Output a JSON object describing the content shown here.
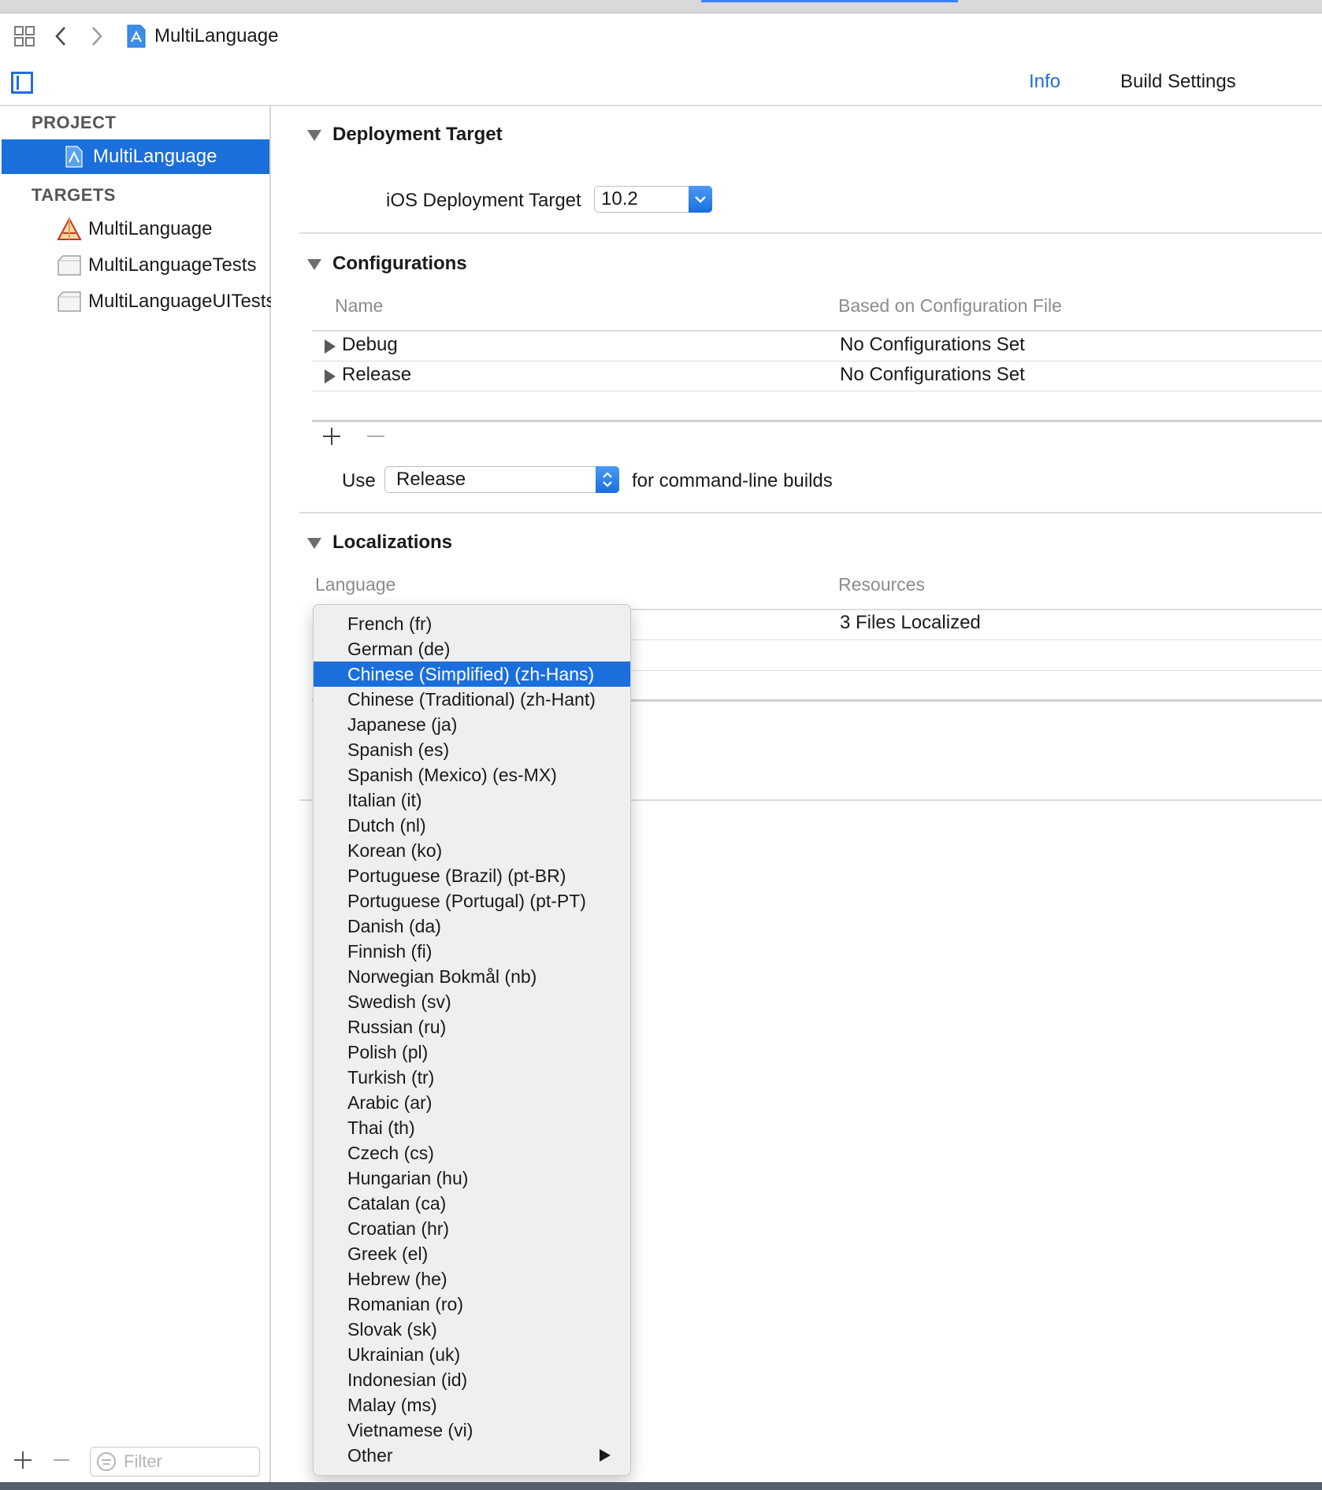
{
  "jumpbar": {
    "breadcrumb": "MultiLanguage"
  },
  "editor_tabs": [
    {
      "label": "Info",
      "active": true
    },
    {
      "label": "Build Settings",
      "active": false
    }
  ],
  "sidebar": {
    "project_header": "PROJECT",
    "project_item": "MultiLanguage",
    "targets_header": "TARGETS",
    "targets": [
      "MultiLanguage",
      "MultiLanguageTests",
      "MultiLanguageUITests"
    ],
    "filter_placeholder": "Filter"
  },
  "deployment": {
    "title": "Deployment Target",
    "label": "iOS Deployment Target",
    "value": "10.2"
  },
  "configurations": {
    "title": "Configurations",
    "col_name": "Name",
    "col_file": "Based on Configuration File",
    "rows": [
      {
        "name": "Debug",
        "file": "No Configurations Set"
      },
      {
        "name": "Release",
        "file": "No Configurations Set"
      }
    ],
    "use_label": "Use",
    "use_value": "Release",
    "use_suffix": "for command-line builds"
  },
  "localizations": {
    "title": "Localizations",
    "col_language": "Language",
    "col_resources": "Resources",
    "row_resources": "3 Files Localized"
  },
  "language_menu": {
    "highlighted_index": 2,
    "items": [
      "French (fr)",
      "German (de)",
      "Chinese (Simplified) (zh-Hans)",
      "Chinese (Traditional) (zh-Hant)",
      "Japanese (ja)",
      "Spanish (es)",
      "Spanish (Mexico) (es-MX)",
      "Italian (it)",
      "Dutch (nl)",
      "Korean (ko)",
      "Portuguese (Brazil) (pt-BR)",
      "Portuguese (Portugal) (pt-PT)",
      "Danish (da)",
      "Finnish (fi)",
      "Norwegian Bokmål (nb)",
      "Swedish (sv)",
      "Russian (ru)",
      "Polish (pl)",
      "Turkish (tr)",
      "Arabic (ar)",
      "Thai (th)",
      "Czech (cs)",
      "Hungarian (hu)",
      "Catalan (ca)",
      "Croatian (hr)",
      "Greek (el)",
      "Hebrew (he)",
      "Romanian (ro)",
      "Slovak (sk)",
      "Ukrainian (uk)",
      "Indonesian (id)",
      "Malay (ms)",
      "Vietnamese (vi)",
      "Other"
    ]
  },
  "colors": {
    "accent": "#1a6fdc",
    "sidebar_selected": "#1a6fdc",
    "menu_bg": "#efefef"
  }
}
